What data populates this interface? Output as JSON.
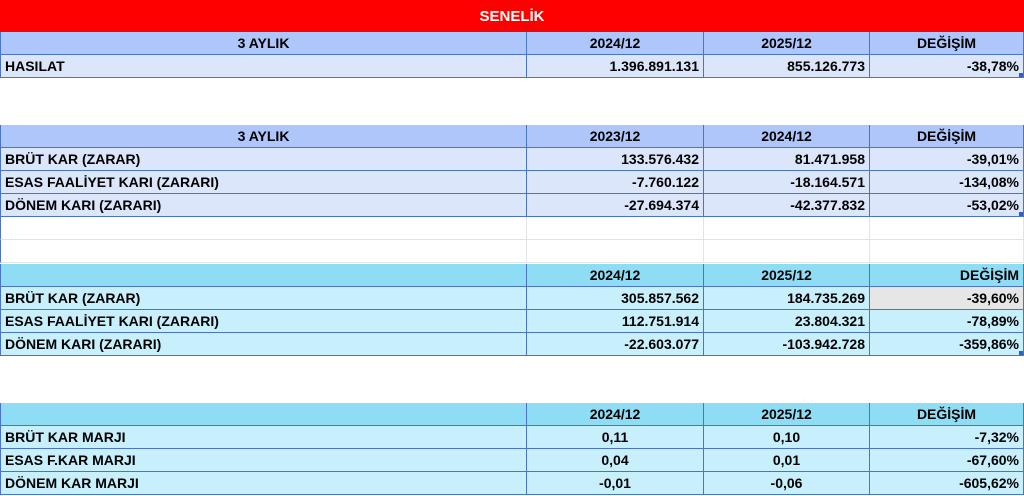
{
  "title": "SENELİK",
  "section1": {
    "header": [
      "3 AYLIK",
      "2024/12",
      "2025/12",
      "DEĞİŞİM"
    ],
    "rows": [
      [
        "HASILAT",
        "1.396.891.131",
        "855.126.773",
        "-38,78%"
      ]
    ]
  },
  "section2": {
    "header": [
      "3 AYLIK",
      "2023/12",
      "2024/12",
      "DEĞİŞİM"
    ],
    "rows": [
      [
        "BRÜT KAR (ZARAR)",
        "133.576.432",
        "81.471.958",
        "-39,01%"
      ],
      [
        "ESAS FAALİYET KARI (ZARARI)",
        "-7.760.122",
        "-18.164.571",
        "-134,08%"
      ],
      [
        "DÖNEM KARI (ZARARI)",
        "-27.694.374",
        "-42.377.832",
        "-53,02%"
      ]
    ]
  },
  "section3": {
    "header": [
      "",
      "2024/12",
      "2025/12",
      "DEĞİŞİM"
    ],
    "rows": [
      [
        "BRÜT KAR (ZARAR)",
        "305.857.562",
        "184.735.269",
        "-39,60%"
      ],
      [
        "ESAS FAALİYET KARI (ZARARI)",
        "112.751.914",
        "23.804.321",
        "-78,89%"
      ],
      [
        "DÖNEM KARI (ZARARI)",
        "-22.603.077",
        "-103.942.728",
        "-359,86%"
      ]
    ]
  },
  "section4": {
    "header": [
      "",
      "2024/12",
      "2025/12",
      "DEĞİŞİM"
    ],
    "rows": [
      [
        "BRÜT KAR MARJI",
        "0,11",
        "0,10",
        "-7,32%"
      ],
      [
        "ESAS F.KAR MARJI",
        "0,04",
        "0,01",
        "-67,60%"
      ],
      [
        "DÖNEM KAR MARJI",
        "-0,01",
        "-0,06",
        "-605,62%"
      ]
    ]
  },
  "colors": {
    "title_bg": "#ff0000",
    "header_blue": "#aec6fa",
    "row_blue": "#dce6fb",
    "header_cyan": "#8fdcf5",
    "row_cyan": "#c8effc",
    "grid_line": "#4a74c9"
  }
}
